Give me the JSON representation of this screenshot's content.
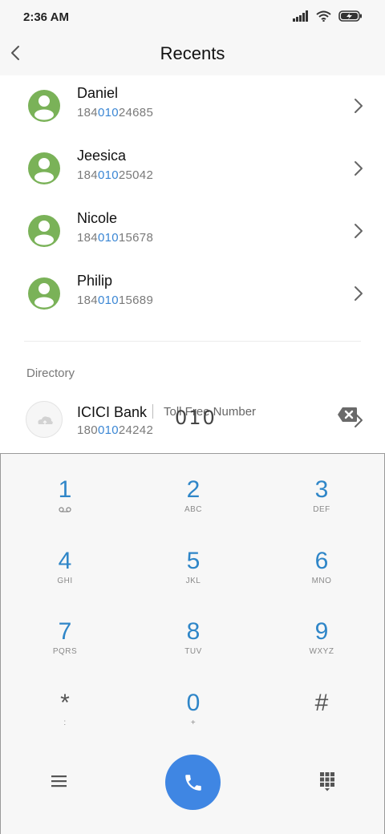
{
  "status": {
    "time": "2:36 AM"
  },
  "header": {
    "title": "Recents"
  },
  "contacts": [
    {
      "name": "Daniel",
      "num_pre": "184",
      "num_hl": "010",
      "num_post": "24685"
    },
    {
      "name": "Jeesica",
      "num_pre": "184",
      "num_hl": "010",
      "num_post": "25042"
    },
    {
      "name": "Nicole",
      "num_pre": "184",
      "num_hl": "010",
      "num_post": "15678"
    },
    {
      "name": "Philip",
      "num_pre": "184",
      "num_hl": "010",
      "num_post": "15689"
    }
  ],
  "directory": {
    "label": "Directory",
    "name": "ICICI Bank",
    "tag": "Toll Free Number",
    "num_pre": "180",
    "num_hl": "010",
    "num_post": "24242"
  },
  "dialer": {
    "input": "010",
    "keys": [
      {
        "digit": "1",
        "letters": ""
      },
      {
        "digit": "2",
        "letters": "ABC"
      },
      {
        "digit": "3",
        "letters": "DEF"
      },
      {
        "digit": "4",
        "letters": "GHI"
      },
      {
        "digit": "5",
        "letters": "JKL"
      },
      {
        "digit": "6",
        "letters": "MNO"
      },
      {
        "digit": "7",
        "letters": "PQRS"
      },
      {
        "digit": "8",
        "letters": "TUV"
      },
      {
        "digit": "9",
        "letters": "WXYZ"
      },
      {
        "digit": "*",
        "letters": ":"
      },
      {
        "digit": "0",
        "letters": "+"
      },
      {
        "digit": "#",
        "letters": ""
      }
    ]
  },
  "colors": {
    "accent": "#3f86e3",
    "digit": "#2f86c8",
    "avatar": "#7ab258",
    "highlight": "#3a86d4"
  },
  "icons": [
    "back-icon",
    "signal-icon",
    "wifi-icon",
    "battery-icon",
    "person-icon",
    "chevron-right-icon",
    "cloud-icon",
    "backspace-icon",
    "voicemail-icon",
    "menu-icon",
    "phone-icon",
    "keypad-icon"
  ]
}
